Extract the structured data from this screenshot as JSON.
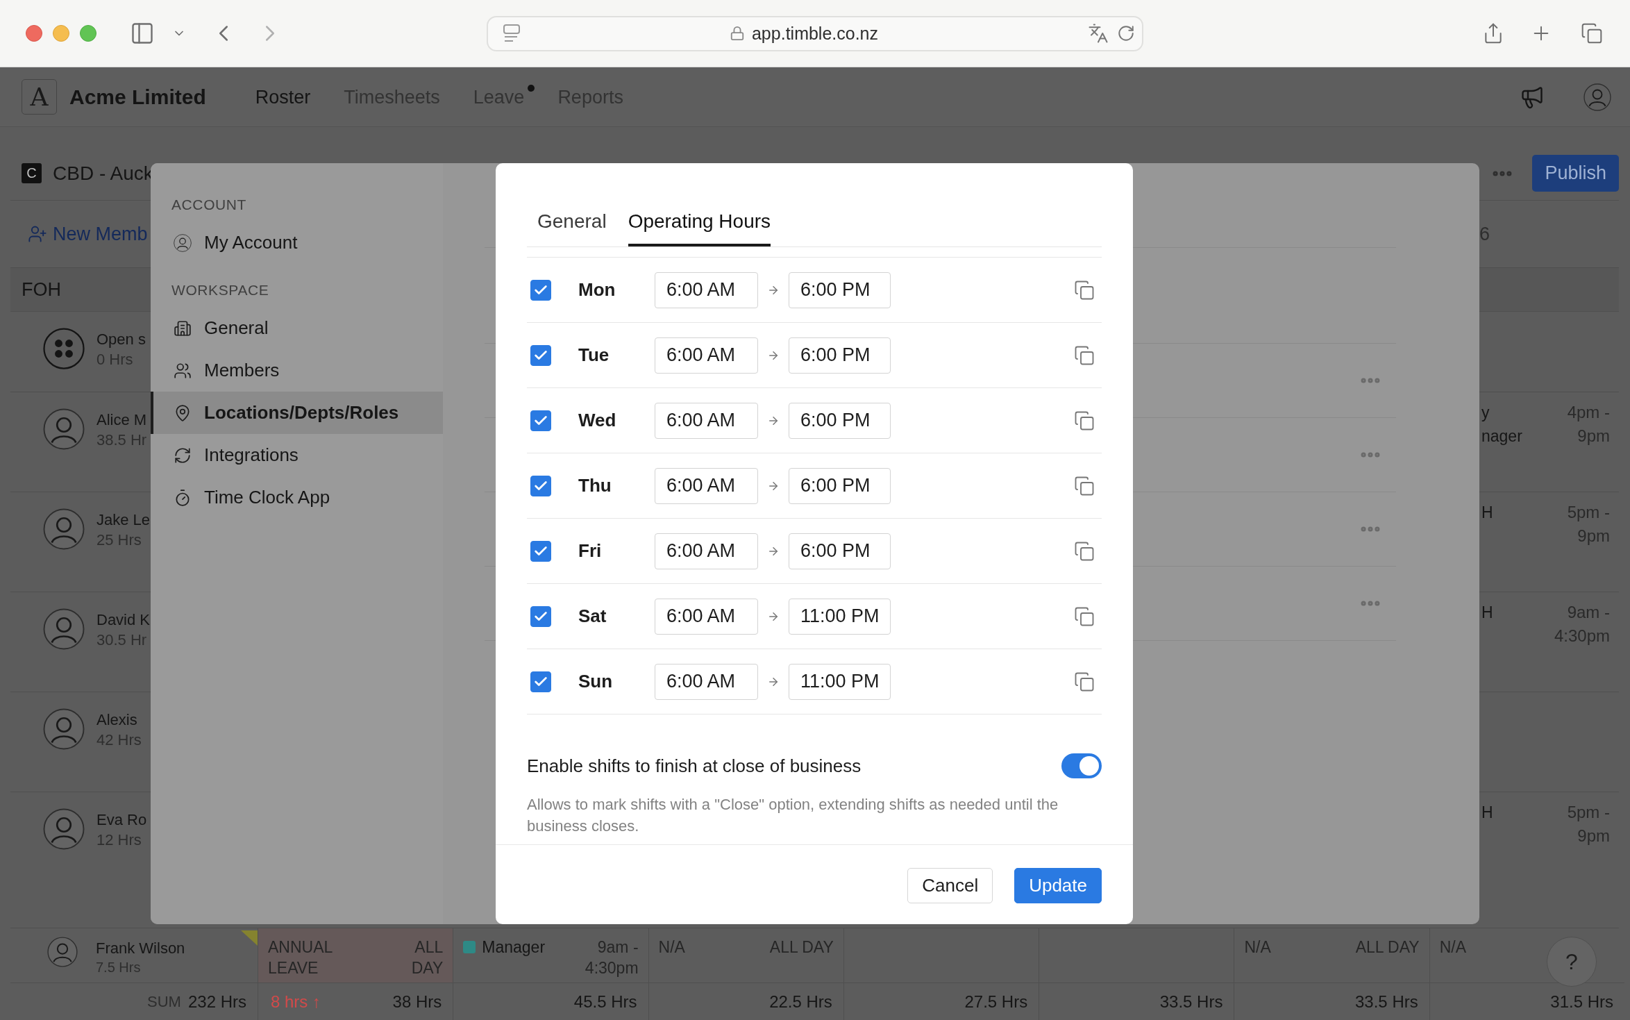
{
  "browser": {
    "url": "app.timble.co.nz"
  },
  "header": {
    "logo": "A",
    "company": "Acme Limited",
    "nav": [
      {
        "label": "Roster",
        "selected": true,
        "dot": false
      },
      {
        "label": "Timesheets",
        "selected": false,
        "dot": false
      },
      {
        "label": "Leave",
        "selected": false,
        "dot": true
      },
      {
        "label": "Reports",
        "selected": false,
        "dot": false
      }
    ]
  },
  "location": {
    "badge": "C",
    "name": "CBD - Auck",
    "publish": "Publish"
  },
  "toolbar": {
    "new_member": "New Memb",
    "column_7_header": "6"
  },
  "roster": {
    "group": "FOH",
    "members": [
      {
        "kind": "open",
        "name": "Open s",
        "hours": "0 Hrs"
      },
      {
        "kind": "person",
        "name": "Alice M",
        "hours": "38.5 Hr",
        "role_lines": [
          "y",
          "nager"
        ],
        "time_lines": [
          "4pm -",
          "9pm"
        ]
      },
      {
        "kind": "person",
        "name": "Jake Le",
        "hours": "25 Hrs",
        "role_lines": [
          "H"
        ],
        "time_lines": [
          "5pm -",
          "9pm"
        ]
      },
      {
        "kind": "person",
        "name": "David K",
        "hours": "30.5 Hr",
        "role_lines": [
          "H"
        ],
        "time_lines": [
          "9am -",
          "4:30pm"
        ]
      },
      {
        "kind": "person",
        "name": "Alexis",
        "hours": "42 Hrs"
      },
      {
        "kind": "person",
        "name": "Eva Ro",
        "hours": "12 Hrs",
        "role_lines": [
          "H"
        ],
        "time_lines": [
          "5pm -",
          "9pm"
        ]
      }
    ]
  },
  "bottom_member": {
    "name": "Frank Wilson",
    "hours": "7.5 Hrs",
    "flagged": true,
    "cells": [
      {
        "kind": "leave",
        "label": "ANNUAL LEAVE",
        "time": "ALL DAY"
      },
      {
        "kind": "shift",
        "role": "Manager",
        "color": "#2e8a86",
        "time": "9am - 4:30pm"
      },
      {
        "kind": "na",
        "label": "N/A",
        "time": "ALL DAY"
      },
      {
        "kind": "empty"
      },
      {
        "kind": "empty"
      },
      {
        "kind": "na",
        "label": "N/A",
        "time": "ALL DAY"
      },
      {
        "kind": "na",
        "label": "N/A"
      }
    ]
  },
  "sums": {
    "label": "SUM",
    "total": "232 Hrs",
    "leave_delta": "8 hrs ↑",
    "values": [
      "38 Hrs",
      "45.5 Hrs",
      "22.5 Hrs",
      "27.5 Hrs",
      "33.5 Hrs",
      "33.5 Hrs",
      "31.5 Hrs"
    ]
  },
  "settings": {
    "sections": [
      {
        "heading": "ACCOUNT",
        "items": [
          {
            "label": "My Account",
            "selected": false
          }
        ]
      },
      {
        "heading": "WORKSPACE",
        "items": [
          {
            "label": "General",
            "selected": false
          },
          {
            "label": "Members",
            "selected": false
          },
          {
            "label": "Locations/Depts/Roles",
            "selected": true
          },
          {
            "label": "Integrations",
            "selected": false
          },
          {
            "label": "Time Clock App",
            "selected": false
          }
        ]
      }
    ],
    "list_rows": [
      {
        "menu": true
      },
      {
        "menu": true
      },
      {
        "menu": true
      },
      {
        "menu": true
      }
    ]
  },
  "modal": {
    "tabs": [
      {
        "label": "General",
        "selected": false
      },
      {
        "label": "Operating Hours",
        "selected": true
      }
    ],
    "days": [
      {
        "day": "Mon",
        "checked": true,
        "open": "6:00 AM",
        "close": "6:00 PM"
      },
      {
        "day": "Tue",
        "checked": true,
        "open": "6:00 AM",
        "close": "6:00 PM"
      },
      {
        "day": "Wed",
        "checked": true,
        "open": "6:00 AM",
        "close": "6:00 PM"
      },
      {
        "day": "Thu",
        "checked": true,
        "open": "6:00 AM",
        "close": "6:00 PM"
      },
      {
        "day": "Fri",
        "checked": true,
        "open": "6:00 AM",
        "close": "6:00 PM"
      },
      {
        "day": "Sat",
        "checked": true,
        "open": "6:00 AM",
        "close": "11:00 PM"
      },
      {
        "day": "Sun",
        "checked": true,
        "open": "6:00 AM",
        "close": "11:00 PM"
      }
    ],
    "close_of_business": {
      "label": "Enable shifts to finish at close of business",
      "on": true,
      "description": "Allows to mark shifts with a \"Close\" option, extending shifts as needed until the business closes."
    },
    "buttons": [
      {
        "kind": "secondary",
        "label": "Cancel"
      },
      {
        "kind": "primary",
        "label": "Update"
      }
    ]
  },
  "help": {
    "label": "?"
  }
}
